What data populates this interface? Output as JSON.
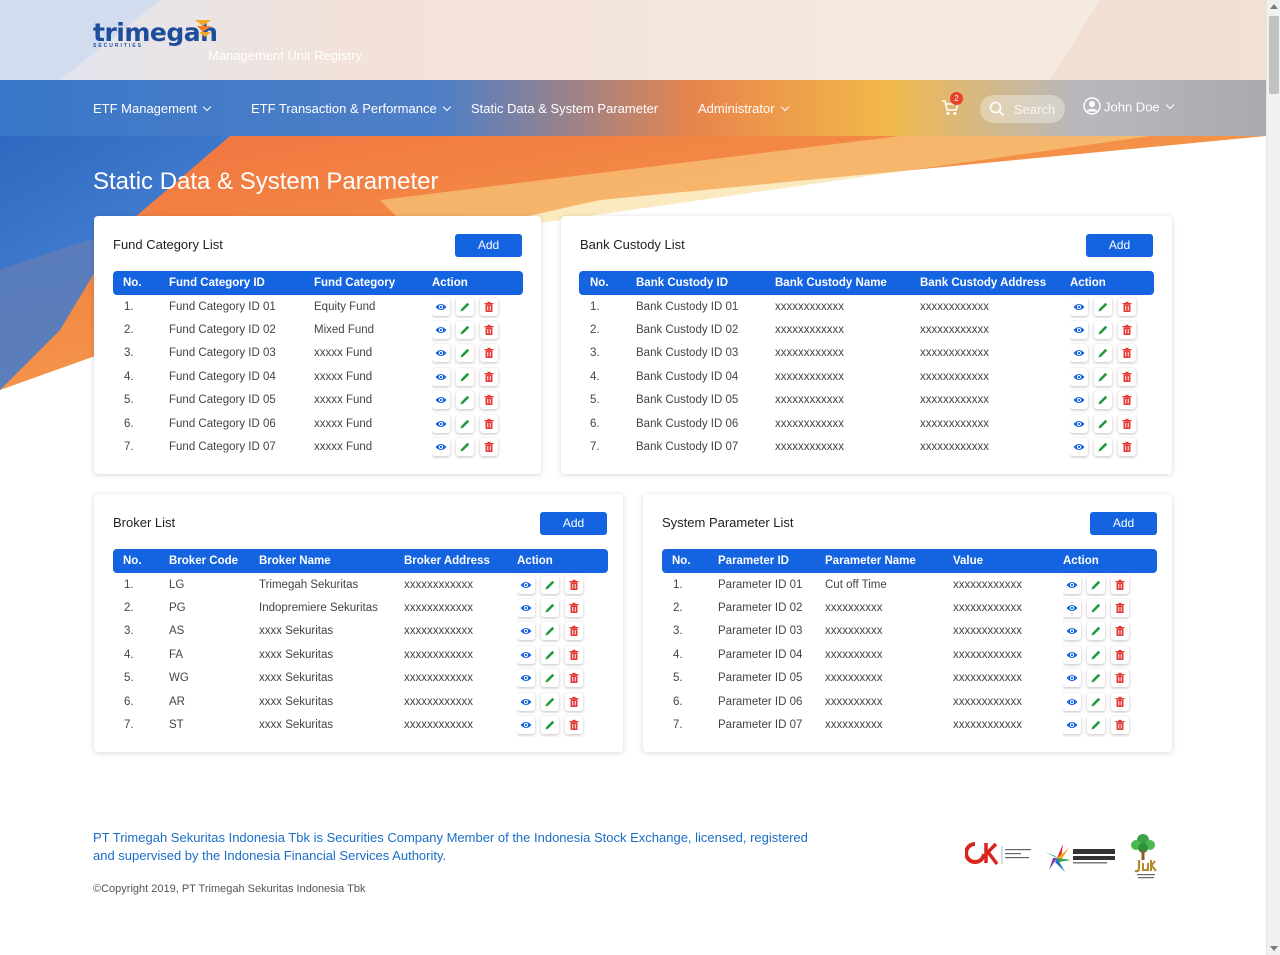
{
  "brand": {
    "name": "trimegah",
    "sub": "SECURITIES",
    "app_subtitle": "Management Unit Registry"
  },
  "nav": {
    "items": [
      {
        "label": "ETF Management",
        "dropdown": true
      },
      {
        "label": "ETF Transaction & Performance",
        "dropdown": true
      },
      {
        "label": "Static Data & System Parameter",
        "dropdown": false
      },
      {
        "label": "Administrator",
        "dropdown": true
      }
    ],
    "cart_count": "2",
    "search_placeholder": "Search",
    "user_name": "John Doe"
  },
  "page_title": "Static Data & System Parameter",
  "fund_category": {
    "title": "Fund Category List",
    "add_label": "Add",
    "headers": [
      "No.",
      "Fund Category ID",
      "Fund Category",
      "Action"
    ],
    "rows": [
      [
        "1.",
        "Fund Category ID 01",
        "Equity Fund"
      ],
      [
        "2.",
        "Fund Category ID 02",
        "Mixed Fund"
      ],
      [
        "3.",
        "Fund Category ID 03",
        "xxxxx Fund"
      ],
      [
        "4.",
        "Fund Category ID 04",
        "xxxxx Fund"
      ],
      [
        "5.",
        "Fund Category ID 05",
        "xxxxx Fund"
      ],
      [
        "6.",
        "Fund Category ID 06",
        "xxxxx Fund"
      ],
      [
        "7.",
        "Fund Category ID 07",
        "xxxxx Fund"
      ]
    ]
  },
  "bank_custody": {
    "title": "Bank Custody List",
    "add_label": "Add",
    "headers": [
      "No.",
      "Bank Custody ID",
      "Bank Custody Name",
      "Bank Custody Address",
      "Action"
    ],
    "rows": [
      [
        "1.",
        "Bank Custody ID 01",
        "xxxxxxxxxxxx",
        "xxxxxxxxxxxx"
      ],
      [
        "2.",
        "Bank Custody ID 02",
        "xxxxxxxxxxxx",
        "xxxxxxxxxxxx"
      ],
      [
        "3.",
        "Bank Custody ID 03",
        "xxxxxxxxxxxx",
        "xxxxxxxxxxxx"
      ],
      [
        "4.",
        "Bank Custody ID 04",
        "xxxxxxxxxxxx",
        "xxxxxxxxxxxx"
      ],
      [
        "5.",
        "Bank Custody ID 05",
        "xxxxxxxxxxxx",
        "xxxxxxxxxxxx"
      ],
      [
        "6.",
        "Bank Custody ID 06",
        "xxxxxxxxxxxx",
        "xxxxxxxxxxxx"
      ],
      [
        "7.",
        "Bank Custody ID 07",
        "xxxxxxxxxxxx",
        "xxxxxxxxxxxx"
      ]
    ]
  },
  "broker": {
    "title": "Broker List",
    "add_label": "Add",
    "headers": [
      "No.",
      "Broker Code",
      "Broker Name",
      "Broker Address",
      "Action"
    ],
    "rows": [
      [
        "1.",
        "LG",
        "Trimegah Sekuritas",
        "xxxxxxxxxxxx"
      ],
      [
        "2.",
        "PG",
        "Indopremiere Sekuritas",
        "xxxxxxxxxxxx"
      ],
      [
        "3.",
        "AS",
        "xxxx Sekuritas",
        "xxxxxxxxxxxx"
      ],
      [
        "4.",
        "FA",
        "xxxx Sekuritas",
        "xxxxxxxxxxxx"
      ],
      [
        "5.",
        "WG",
        "xxxx Sekuritas",
        "xxxxxxxxxxxx"
      ],
      [
        "6.",
        "AR",
        "xxxx Sekuritas",
        "xxxxxxxxxxxx"
      ],
      [
        "7.",
        "ST",
        "xxxx Sekuritas",
        "xxxxxxxxxxxx"
      ]
    ]
  },
  "system_parameter": {
    "title": "System Parameter List",
    "add_label": "Add",
    "headers": [
      "No.",
      "Parameter ID",
      "Parameter Name",
      "Value",
      "Action"
    ],
    "rows": [
      [
        "1.",
        "Parameter ID 01",
        "Cut off Time",
        "xxxxxxxxxxxx"
      ],
      [
        "2.",
        "Parameter ID 02",
        "xxxxxxxxxx",
        "xxxxxxxxxxxx"
      ],
      [
        "3.",
        "Parameter ID 03",
        "xxxxxxxxxx",
        "xxxxxxxxxxxx"
      ],
      [
        "4.",
        "Parameter ID 04",
        "xxxxxxxxxx",
        "xxxxxxxxxxxx"
      ],
      [
        "5.",
        "Parameter ID 05",
        "xxxxxxxxxx",
        "xxxxxxxxxxxx"
      ],
      [
        "6.",
        "Parameter ID 06",
        "xxxxxxxxxx",
        "xxxxxxxxxxxx"
      ],
      [
        "7.",
        "Parameter ID 07",
        "xxxxxxxxxx",
        "xxxxxxxxxxxx"
      ]
    ]
  },
  "row_actions": [
    "eye-icon",
    "pencil-icon",
    "trash-icon"
  ],
  "footer": {
    "statement": "PT Trimegah Sekuritas Indonesia Tbk is Securities Company Member of the Indonesia Stock Exchange, licensed, registered and supervised by the Indonesia Financial Services Authority.",
    "copyright": "©Copyright 2019, PT Trimegah Sekuritas Indonesia Tbk",
    "logos": [
      "ojk-logo",
      "inklusi-keuangan-logo",
      "yuk-nabung-saham-logo"
    ]
  },
  "colors": {
    "primary": "#1463e0",
    "nav_blue": "#2f6fc4",
    "accent_orange": "#f47c3c",
    "accent_yellow": "#f5b535",
    "link_blue": "#1a6ec8",
    "edit_green": "#1f9a3c",
    "delete_red": "#e53935"
  }
}
